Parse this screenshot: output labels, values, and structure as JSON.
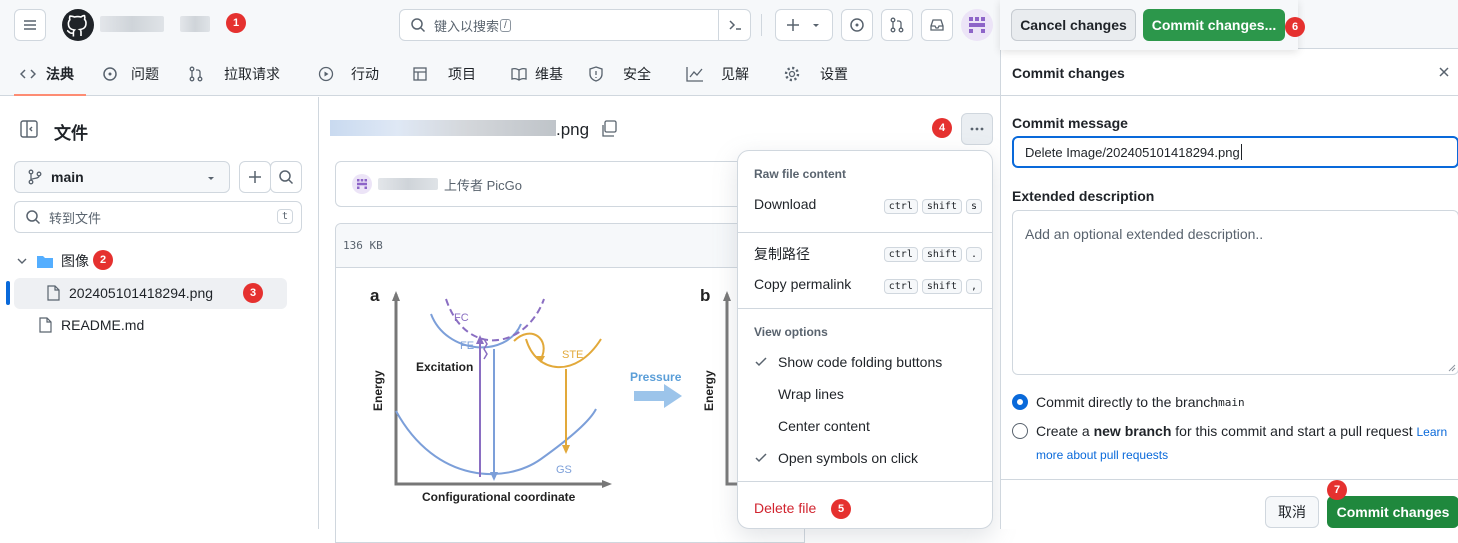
{
  "header": {
    "search_placeholder": "键入以搜索",
    "search_shortcut": "/"
  },
  "nav": {
    "tabs": [
      "法典",
      "问题",
      "拉取请求",
      "行动",
      "项目",
      "维基",
      "安全",
      "见解",
      "设置"
    ]
  },
  "sidebar": {
    "title": "文件",
    "branch": "main",
    "filter_placeholder": "转到文件",
    "filter_shortcut": "t",
    "tree": {
      "folder": "图像",
      "file_png": "202405101418294.png",
      "readme": "README.md"
    }
  },
  "file": {
    "name_suffix": ".png",
    "uploader": "上传者 PicGo",
    "size": "136 KB"
  },
  "figure": {
    "panel_a": "a",
    "panel_b": "b",
    "energy": "Energy",
    "fc": "FC",
    "fe": "FE",
    "excitation": "Excitation",
    "ste": "STE",
    "gs": "GS",
    "pressure": "Pressure",
    "xaxis": "Configurational coordinate"
  },
  "menu": {
    "raw_header": "Raw file content",
    "download": "Download",
    "copy_path": "复制路径",
    "copy_permalink": "Copy permalink",
    "view_header": "View options",
    "show_folding": "Show code folding buttons",
    "wrap_lines": "Wrap lines",
    "center_content": "Center content",
    "open_symbols": "Open symbols on click",
    "delete_file": "Delete file",
    "k_ctrl": "ctrl",
    "k_shift": "shift",
    "k_s": "s",
    "k_dot": ".",
    "k_comma": ","
  },
  "commit": {
    "cancel_top": "Cancel changes",
    "commit_top": "Commit changes...",
    "title": "Commit changes",
    "msg_label": "Commit message",
    "msg_value": "Delete Image/202405101418294.png",
    "ext_label": "Extended description",
    "ext_placeholder": "Add an optional extended description..",
    "radio1_text": "Commit directly to the branch",
    "radio1_branch": "main",
    "radio2_pre": "Create a ",
    "radio2_bold": "new branch",
    "radio2_post": " for this commit and start a pull request ",
    "learn1": "Learn",
    "learn2": "more about pull requests",
    "cancel": "取消",
    "submit": "Commit changes"
  },
  "badges": [
    "1",
    "2",
    "3",
    "4",
    "5",
    "6",
    "7"
  ],
  "colors": {
    "green": "#1f883d",
    "blue": "#0969da",
    "danger": "#d1242f",
    "badge": "#e5312f"
  }
}
